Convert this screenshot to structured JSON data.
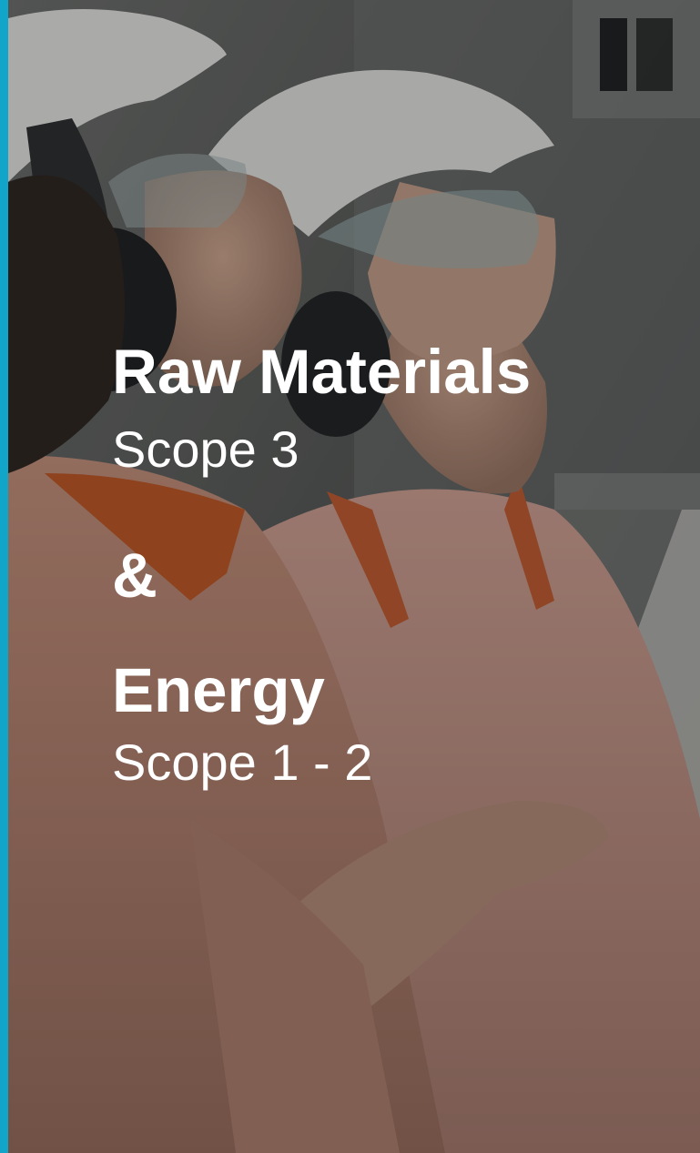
{
  "slide": {
    "heading_1": "Raw Materials",
    "subheading_1": "Scope 3",
    "connector": "&",
    "heading_2": "Energy",
    "subheading_2": "Scope 1 - 2"
  },
  "photo": {
    "description_icon": "two-workers-in-hard-hats-photo"
  },
  "colors": {
    "accent_bar": "#10a5c9",
    "text": "#ffffff"
  }
}
